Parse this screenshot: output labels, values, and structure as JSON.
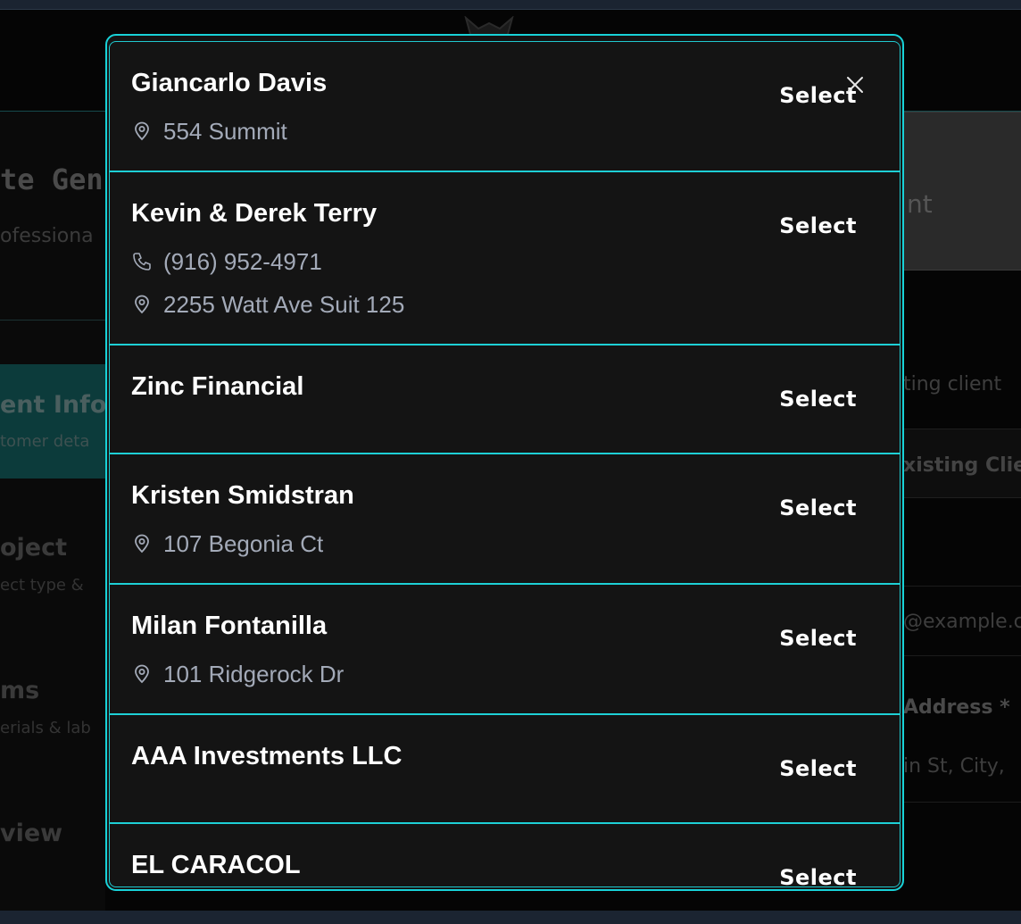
{
  "background": {
    "page_title": "te Gen",
    "page_subtitle": "ofessiona",
    "steps": [
      {
        "title": "ent Info",
        "sub": "tomer deta"
      },
      {
        "title": "oject",
        "sub": "ect type &"
      },
      {
        "title": "ms",
        "sub": "erials & lab"
      },
      {
        "title": "view",
        "sub": ""
      }
    ],
    "right_box_text": "nt",
    "right_hint": "ting client",
    "right_button": "xisting Clie",
    "right_email_placeholder": "@example.c",
    "right_address_label": "Address *",
    "right_address_placeholder": "in St, City,"
  },
  "modal": {
    "close_icon": "close-icon",
    "select_label": "Select",
    "clients": [
      {
        "name": "Giancarlo Davis",
        "phone": "",
        "address": "554 Summit"
      },
      {
        "name": "Kevin & Derek Terry",
        "phone": "(916) 952-4971",
        "address": "2255 Watt Ave Suit 125"
      },
      {
        "name": "Zinc Financial",
        "phone": "",
        "address": ""
      },
      {
        "name": "Kristen Smidstran",
        "phone": "",
        "address": "107 Begonia Ct"
      },
      {
        "name": "Milan Fontanilla",
        "phone": "",
        "address": "101 Ridgerock Dr"
      },
      {
        "name": "AAA Investments LLC",
        "phone": "",
        "address": ""
      },
      {
        "name": "EL CARACOL",
        "phone": "",
        "address": ""
      }
    ]
  },
  "colors": {
    "accent": "#18d2d8",
    "modal_bg": "#141414",
    "muted_text": "#a3aab8"
  }
}
